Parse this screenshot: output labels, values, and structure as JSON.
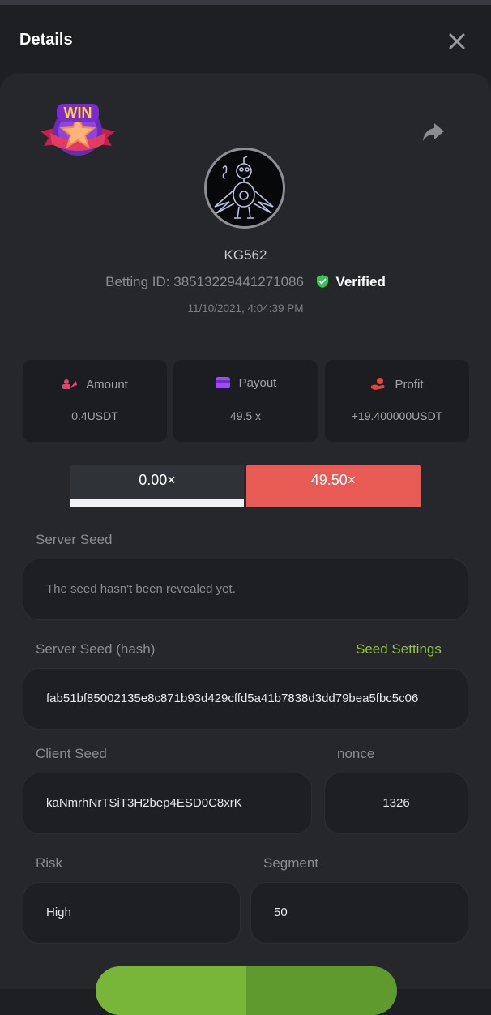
{
  "header": {
    "title": "Details"
  },
  "bet": {
    "badge_text": "WIN",
    "username": "KG562",
    "betting_id_label": "Betting ID:",
    "betting_id": "38513229441271086",
    "verified_label": "Verified",
    "timestamp": "11/10/2021, 4:04:39 PM"
  },
  "stats": [
    {
      "label": "Amount",
      "value": "0.4USDT",
      "icon": "coins-icon",
      "color": "#e0476f"
    },
    {
      "label": "Payout",
      "value": "49.5 x",
      "icon": "card-icon",
      "color": "#9a4df0"
    },
    {
      "label": "Profit",
      "value": "+19.400000USDT",
      "icon": "hand-coin-icon",
      "color": "#e5453b"
    }
  ],
  "multipliers": {
    "left": "0.00×",
    "right": "49.50×"
  },
  "fields": {
    "server_seed_label": "Server Seed",
    "server_seed_value": "The seed hasn't been revealed yet.",
    "server_seed_hash_label": "Server Seed (hash)",
    "seed_settings_label": "Seed Settings",
    "server_seed_hash_value": "fab51bf85002135e8c871b93d429cffd5a41b7838d3dd79bea5fbc5c06",
    "client_seed_label": "Client Seed",
    "client_seed_value": "kaNmrhNrTSiT3H2bep4ESD0C8xrK",
    "nonce_label": "nonce",
    "nonce_value": "1326",
    "risk_label": "Risk",
    "risk_value": "High",
    "segment_label": "Segment",
    "segment_value": "50"
  },
  "colors": {
    "accent_green": "#8ec53c",
    "danger_red": "#e85a54",
    "verified_green": "#3cc05a"
  }
}
